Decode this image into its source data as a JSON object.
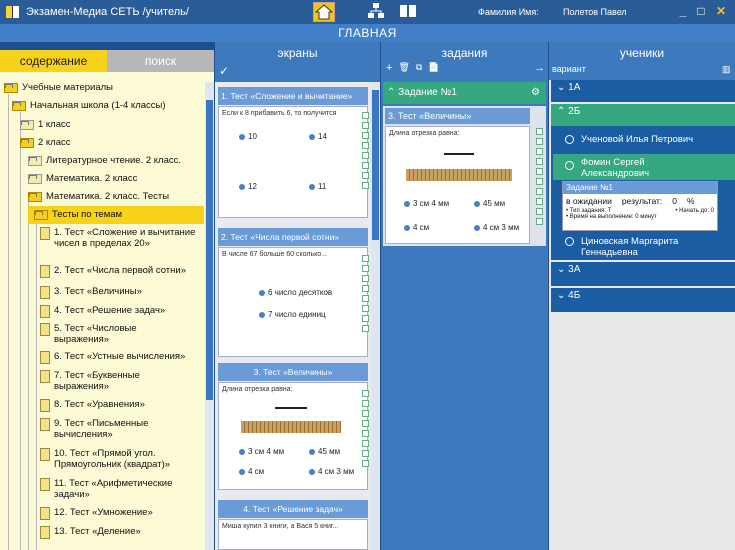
{
  "titlebar": {
    "title": "Экзамен-Медиа СЕТЬ /учитель/",
    "user_label": "Фамилия Имя:",
    "user_name": "Полетов Павел",
    "controls": [
      "_",
      "□",
      "✕"
    ],
    "icons": [
      "app-book-icon",
      "home-icon",
      "network-icon",
      "book-icon"
    ]
  },
  "main_title": "ГЛАВНАЯ",
  "left": {
    "tabs": [
      "содержание",
      "поиск"
    ],
    "tree": [
      "Учебные материалы",
      "Начальная школа (1-4 классы)",
      "1 класс",
      "2 класс",
      "Литературное чтение. 2 класс.",
      "Математика. 2 класс",
      "Математика. 2 класс. Тесты",
      "Тесты по темам",
      "1. Тест «Сложение и вычитание чисел в пределах 20»",
      "2. Тест «Числа первой сотни»",
      "3. Тест «Величины»",
      "4. Тест «Решение задач»",
      "5. Тест «Числовые выражения»",
      "6. Тест «Устные вычисления»",
      "7. Тест «Буквенные выражения»",
      "8. Тест «Уравнения»",
      "9. Тест «Письменные вычисления»",
      "10. Тест «Прямой угол. Прямоугольник (квадрат)»",
      "11. Тест «Арифметические задачи»",
      "12. Тест «Умножение»",
      "13. Тест «Деление»"
    ]
  },
  "screens": {
    "header": "экраны",
    "check": "✓",
    "cards": [
      {
        "title": "1. Тест «Сложение и вычитание»",
        "prompt": "Если к 8 прибавить 6, то получится",
        "answers": [
          "10",
          "14",
          "12",
          "11"
        ]
      },
      {
        "title": "2. Тест «Числа первой сотни»",
        "prompt": "В числе 67 больше 60 сколько...",
        "answers": [
          "6 число десятков",
          "7 число единиц"
        ]
      },
      {
        "title": "3. Тест «Величины»",
        "prompt": "Длина отрезка равна:",
        "answers": [
          "3 см 4 мм",
          "45 мм",
          "4 см",
          "4 см 3 мм"
        ]
      },
      {
        "title": "4. Тест «Решение задач»",
        "prompt": "Миша купил 3 книги, а Вася 5 книг..."
      }
    ]
  },
  "tasks": {
    "header": "задания",
    "toolbar": [
      "+",
      "🗑",
      "⧉",
      "📄",
      "→"
    ],
    "task": "Задание №1",
    "screen_title": "3. Тест «Величины»",
    "prompt": "Длина отрезка равна:",
    "answers": [
      "3 см 4 мм",
      "45 мм",
      "4 см",
      "4 см 3 мм"
    ]
  },
  "students": {
    "header": "ученики",
    "sub": "вариант",
    "groups": [
      "1А",
      "2Б",
      "3А",
      "4Б"
    ],
    "members": [
      "Ученовой Илья Петрович",
      "Фомин Сергей Александрович",
      "Циновская Маргарита Геннадьевна"
    ],
    "detail": {
      "task": "Задание №1",
      "status": "в ожидании",
      "result_label": "результат:",
      "result_value": "0",
      "percent": "%",
      "line1": "• Тип задания: Т",
      "line2": "• Начать до: 0",
      "line3": "• Время на выполнение: 0 минут"
    }
  }
}
